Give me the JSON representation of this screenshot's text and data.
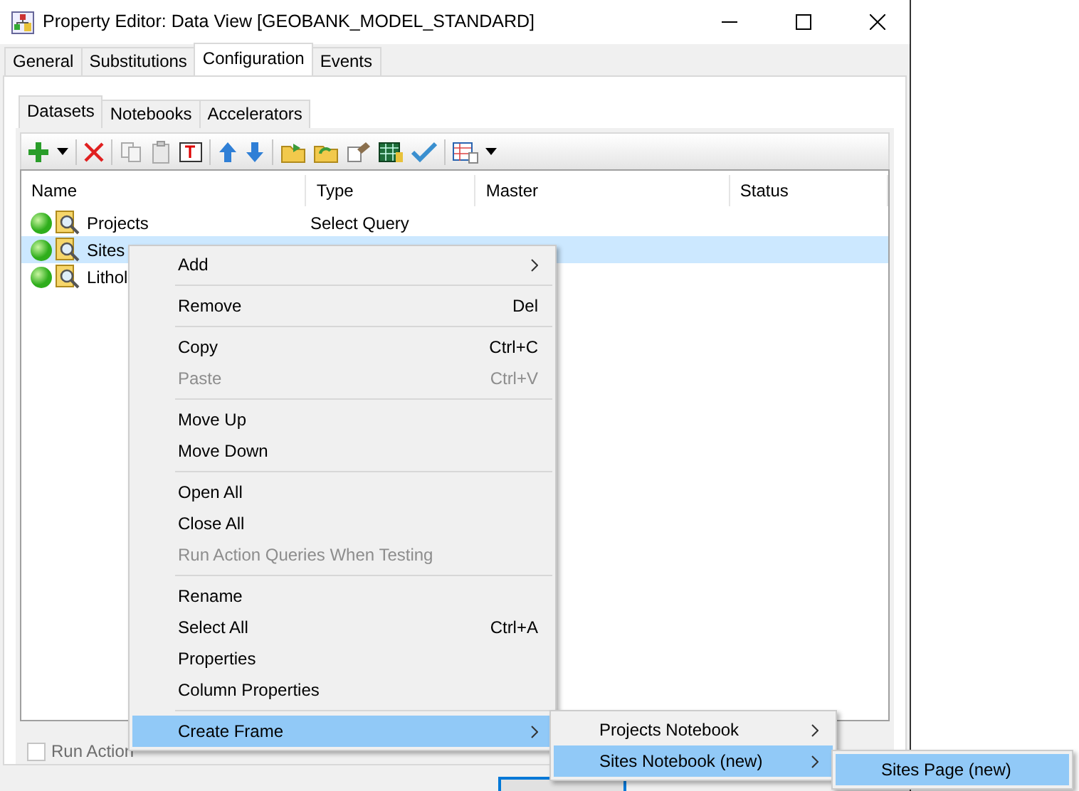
{
  "window": {
    "title": "Property Editor: Data View [GEOBANK_MODEL_STANDARD]"
  },
  "tabs": [
    {
      "label": "General",
      "selected": false
    },
    {
      "label": "Substitutions",
      "selected": false
    },
    {
      "label": "Configuration",
      "selected": true
    },
    {
      "label": "Events",
      "selected": false
    }
  ],
  "inner_tabs": [
    {
      "label": "Datasets",
      "selected": true
    },
    {
      "label": "Notebooks",
      "selected": false
    },
    {
      "label": "Accelerators",
      "selected": false
    }
  ],
  "table": {
    "columns": [
      "Name",
      "Type",
      "Master",
      "Status"
    ],
    "rows": [
      {
        "name": "Projects",
        "type": "Select Query",
        "selected": false
      },
      {
        "name": "Sites",
        "selected": true
      },
      {
        "name": "Lithol",
        "selected": false
      }
    ]
  },
  "run_action_checkbox": {
    "label": "Run Action",
    "checked": false
  },
  "context_menu": {
    "items": [
      {
        "kind": "item",
        "label": "Add",
        "submenu": true,
        "disabled": false,
        "selected": false
      },
      {
        "kind": "separator"
      },
      {
        "kind": "item",
        "label": "Remove",
        "shortcut": "Del",
        "disabled": false,
        "selected": false
      },
      {
        "kind": "separator"
      },
      {
        "kind": "item",
        "label": "Copy",
        "shortcut": "Ctrl+C",
        "disabled": false,
        "selected": false
      },
      {
        "kind": "item",
        "label": "Paste",
        "shortcut": "Ctrl+V",
        "disabled": true,
        "selected": false
      },
      {
        "kind": "separator"
      },
      {
        "kind": "item",
        "label": "Move Up",
        "disabled": false,
        "selected": false
      },
      {
        "kind": "item",
        "label": "Move Down",
        "disabled": false,
        "selected": false
      },
      {
        "kind": "separator"
      },
      {
        "kind": "item",
        "label": "Open All",
        "disabled": false,
        "selected": false
      },
      {
        "kind": "item",
        "label": "Close All",
        "disabled": false,
        "selected": false
      },
      {
        "kind": "item",
        "label": "Run Action Queries When Testing",
        "disabled": true,
        "selected": false
      },
      {
        "kind": "separator"
      },
      {
        "kind": "item",
        "label": "Rename",
        "disabled": false,
        "selected": false
      },
      {
        "kind": "item",
        "label": "Select All",
        "shortcut": "Ctrl+A",
        "disabled": false,
        "selected": false
      },
      {
        "kind": "item",
        "label": "Properties",
        "disabled": false,
        "selected": false
      },
      {
        "kind": "item",
        "label": "Column Properties",
        "disabled": false,
        "selected": false
      },
      {
        "kind": "separator"
      },
      {
        "kind": "item",
        "label": "Create Frame",
        "submenu": true,
        "disabled": false,
        "selected": true
      }
    ]
  },
  "submenu_1": {
    "items": [
      {
        "kind": "item",
        "label": "Projects Notebook",
        "submenu": true,
        "disabled": false,
        "selected": false
      },
      {
        "kind": "item",
        "label": "Sites Notebook (new)",
        "submenu": true,
        "disabled": false,
        "selected": true
      }
    ]
  },
  "submenu_2": {
    "items": [
      {
        "kind": "item",
        "label": "Sites Page (new)",
        "submenu": false,
        "disabled": false,
        "selected": true
      }
    ]
  }
}
